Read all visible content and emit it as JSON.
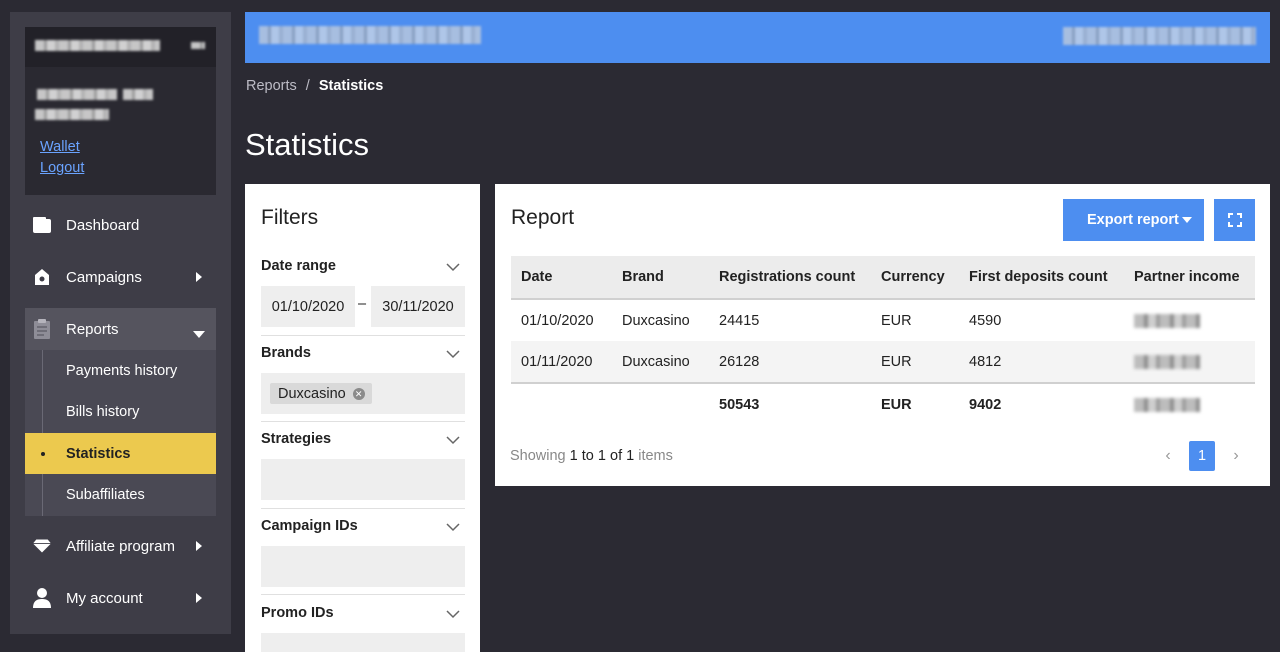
{
  "sidebar": {
    "links": {
      "wallet": "Wallet",
      "logout": "Logout"
    },
    "items": [
      {
        "label": "Dashboard",
        "icon": "wallet-icon"
      },
      {
        "label": "Campaigns",
        "icon": "store-icon"
      },
      {
        "label": "Reports",
        "icon": "clipboard-icon"
      },
      {
        "label": "Affiliate program",
        "icon": "diamond-icon"
      },
      {
        "label": "My account",
        "icon": "user-icon"
      }
    ],
    "submenu": [
      "Payments history",
      "Bills history",
      "Statistics",
      "Subaffiliates"
    ]
  },
  "breadcrumb": {
    "parent": "Reports",
    "separator": "/",
    "current": "Statistics"
  },
  "page_title": "Statistics",
  "filters": {
    "title": "Filters",
    "date_range": {
      "label": "Date range",
      "from": "01/10/2020",
      "dash": "–",
      "to": "30/11/2020"
    },
    "brands": {
      "label": "Brands",
      "chip": "Duxcasino"
    },
    "strategies": {
      "label": "Strategies"
    },
    "campaign_ids": {
      "label": "Campaign IDs"
    },
    "promo_ids": {
      "label": "Promo IDs"
    }
  },
  "report": {
    "title": "Report",
    "export_label": "Export report",
    "columns": [
      "Date",
      "Brand",
      "Registrations count",
      "Currency",
      "First deposits count",
      "Partner income"
    ],
    "rows": [
      [
        "01/10/2020",
        "Duxcasino",
        "24415",
        "EUR",
        "4590"
      ],
      [
        "01/11/2020",
        "Duxcasino",
        "26128",
        "EUR",
        "4812"
      ]
    ],
    "totals": {
      "registrations": "50543",
      "currency": "EUR",
      "first_deposits": "9402"
    },
    "showing": {
      "prefix": "Showing",
      "from": "1",
      "to_word": "to",
      "to": "1",
      "of_word": "of",
      "total": "1",
      "suffix": "items"
    },
    "page": "1"
  },
  "colors": {
    "accent": "#4d8ef0",
    "selected": "#ecc94e",
    "background": "#2b2a33"
  }
}
